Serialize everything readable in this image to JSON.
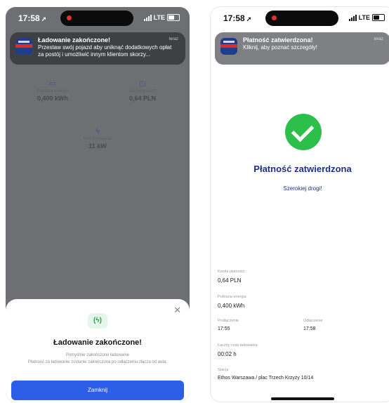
{
  "left_screen": {
    "status": {
      "time": "17:58",
      "network": "LTE"
    },
    "notification": {
      "title": "Ładowanie zakończone!",
      "time": "teraz",
      "body": "Przestaw swój pojazd aby uniknąć dodatkowych opłat za postój i umożliwić innym klientom skorzy..."
    },
    "metrics": [
      {
        "label": "Pobrana energia",
        "value": "0,400 kWh",
        "icon": "plug-icon"
      },
      {
        "label": "Aktualny koszt",
        "value": "0,64 PLN",
        "icon": "wallet-icon"
      },
      {
        "label": "Moc ładowania",
        "value": "11 kW",
        "icon": "bolt-icon"
      }
    ],
    "sheet": {
      "title": "Ładowanie zakończone!",
      "subtitle": "Pomyślnie zakończono ładowanie",
      "description": "Płatność za ładowanie zostanie zakończona po odłączeniu złącza od auta.",
      "button_label": "Zamknij"
    }
  },
  "right_screen": {
    "status": {
      "time": "17:58",
      "network": "LTE"
    },
    "notification": {
      "title": "Płatność zatwierdzona!",
      "time": "teraz",
      "body": "Kliknij, aby poznać szczegóły!"
    },
    "title": "Płatność zatwierdzona",
    "subtitle": "Szerokiej drogi!",
    "details": {
      "cost_label": "Kwota płatności",
      "cost_value": "0,64 PLN",
      "energy_label": "Pobrana energia",
      "energy_value": "0,400 kWh",
      "start_label": "Podłączenie",
      "start_value": "17:55",
      "end_label": "Odłączenie",
      "end_value": "17:58",
      "duration_label": "Łączny czas ładowania",
      "duration_value": "00:02 h",
      "station_label": "Stacja",
      "station_value": "Ethos Warszawa / plac Trzech Krzyży 10/14"
    }
  }
}
